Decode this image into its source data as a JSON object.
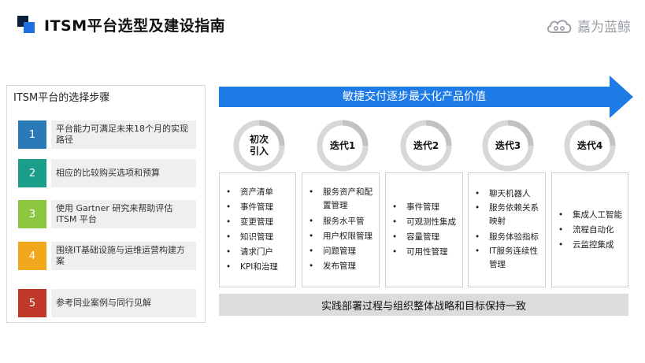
{
  "header": {
    "title": "ITSM平台选型及建设指南",
    "brand": "嘉为蓝鲸",
    "brand_icon": "cloud-logo-icon"
  },
  "steps_panel": {
    "title": "ITSM平台的选择步骤",
    "steps": [
      {
        "num": "1",
        "text": "平台能力可满足未来18个月的实现路径",
        "color": "#2a7ab8"
      },
      {
        "num": "2",
        "text": "相应的比较购买选项和预算",
        "color": "#1a9e8a"
      },
      {
        "num": "3",
        "text": "使用 Gartner 研究来帮助评估 ITSM 平台",
        "color": "#8dc63f"
      },
      {
        "num": "4",
        "text": "围绕IT基础设施与运维运营构建方案",
        "color": "#f2a81d"
      },
      {
        "num": "5",
        "text": "参考同业案例与同行见解",
        "color": "#c0392b"
      }
    ]
  },
  "arrow": {
    "label": "敏捷交付逐步最大化产品价值",
    "color": "#1e7be6"
  },
  "phases": [
    {
      "label": "初次\n引入",
      "items": [
        "资产清单",
        "事件管理",
        "变更管理",
        "知识管理",
        "请求门户",
        "KPI和治理"
      ]
    },
    {
      "label": "迭代1",
      "items": [
        "服务资产和配置管理",
        "服务水平管",
        "用户权限管理",
        "问题管理",
        "发布管理"
      ]
    },
    {
      "label": "迭代2",
      "items": [
        "事件管理",
        "可观测性集成",
        "容量管理",
        "可用性管理"
      ]
    },
    {
      "label": "迭代3",
      "items": [
        "聊天机器人",
        "服务依赖关系映射",
        "服务体验指标",
        "IT服务连续性管理"
      ]
    },
    {
      "label": "迭代4",
      "items": [
        "集成人工智能",
        "流程自动化",
        "云监控集成"
      ]
    }
  ],
  "bottom_bar": {
    "text": "实践部署过程与组织整体战略和目标保持一致"
  }
}
